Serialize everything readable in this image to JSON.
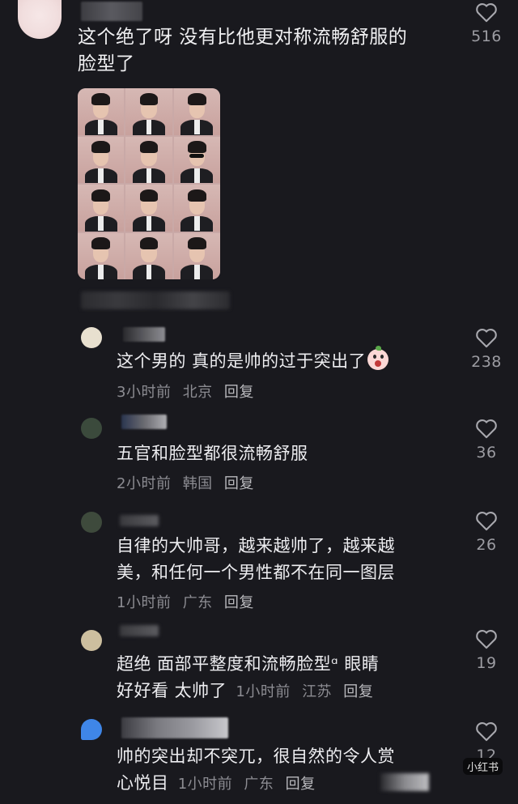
{
  "main_comment": {
    "text_line1": "这个绝了呀 没有比他更对称流畅舒服的",
    "text_line2": "脸型了",
    "likes": "516"
  },
  "replies": [
    {
      "text_line1": "这个男的 真的是帅的过于突出了",
      "time": "3小时前",
      "location": "北京",
      "reply": "回复",
      "likes": "238",
      "has_emoji": true
    },
    {
      "text_line1": "五官和脸型都很流畅舒服",
      "time": "2小时前",
      "location": "韩国",
      "reply": "回复",
      "likes": "36"
    },
    {
      "text_line1": "自律的大帅哥，越来越帅了，越来越",
      "text_line2": "美，和任何一个男性都不在同一图层",
      "time": "1小时前",
      "location": "广东",
      "reply": "回复",
      "likes": "26"
    },
    {
      "text_line1": "超绝 面部平整度和流畅脸型ᵅ 眼睛",
      "text_line2": "好好看 太帅了",
      "time": "1小时前",
      "location": "江苏",
      "reply": "回复",
      "likes": "19"
    },
    {
      "text_line1": "帅的突出却不突兀，很自然的令人赏",
      "text_line2": "心悦目",
      "time": "1小时前",
      "location": "广东",
      "reply": "回复",
      "likes": "12"
    }
  ],
  "watermark": {
    "brand": "小红书"
  },
  "colors": {
    "background": "#19191e",
    "text": "#ededf0",
    "meta": "#8c8c92"
  }
}
